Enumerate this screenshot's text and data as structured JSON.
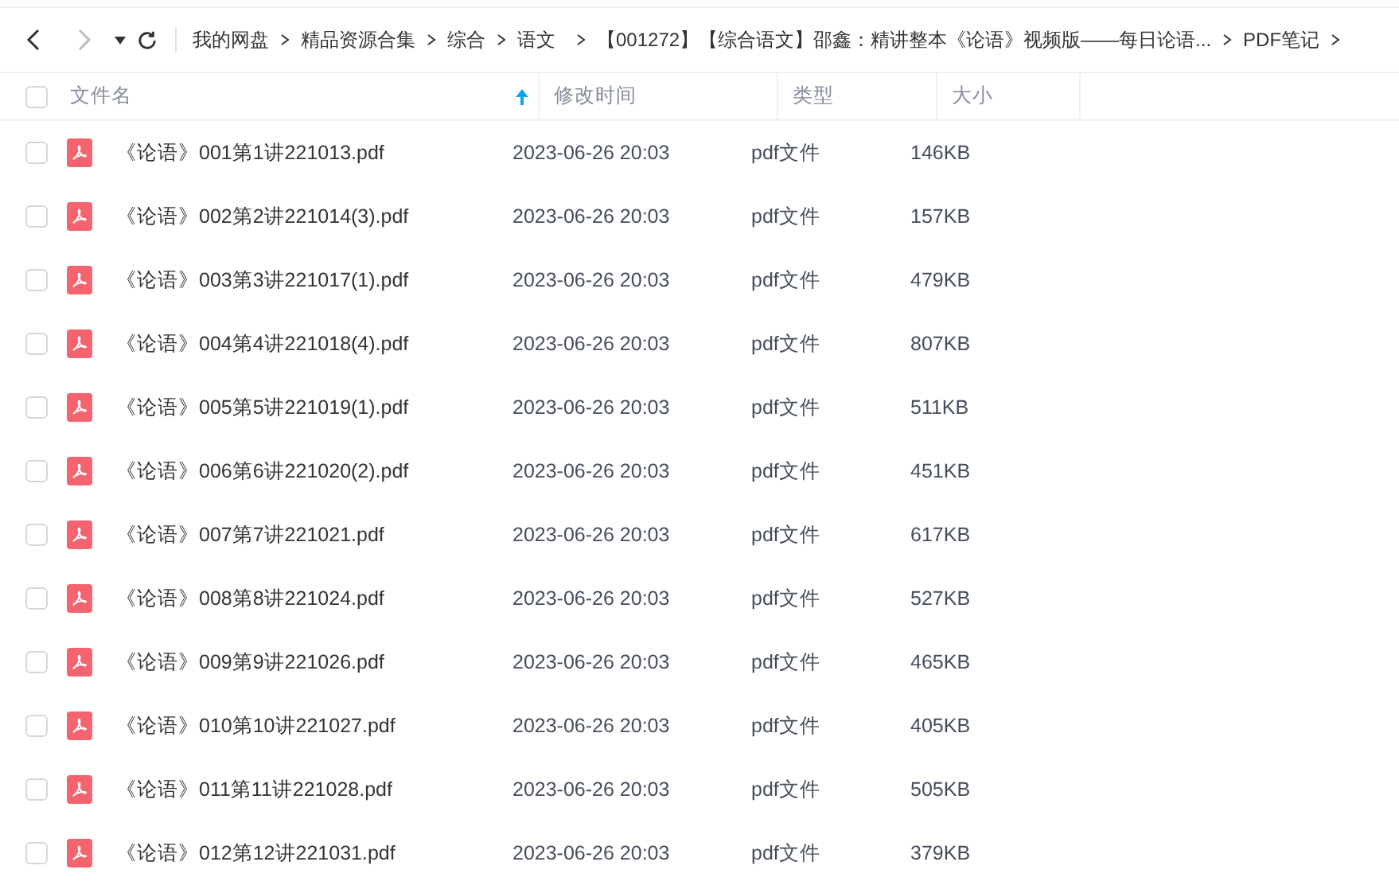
{
  "breadcrumbs": [
    "我的网盘",
    "精品资源合集",
    "综合",
    "语文",
    "【001272】【综合语文】邵鑫：精讲整本《论语》视频版——每日论语...",
    "PDF笔记"
  ],
  "columns": [
    {
      "label": "文件名",
      "sorted": true
    },
    {
      "label": "修改时间",
      "sorted": false
    },
    {
      "label": "类型",
      "sorted": false
    },
    {
      "label": "大小",
      "sorted": false
    }
  ],
  "select_all": {
    "checked": false
  },
  "rows": [
    {
      "name": "《论语》001第1讲221013.pdf",
      "modified": "2023-06-26 20:03",
      "type": "pdf文件",
      "size": "146KB",
      "checked": false
    },
    {
      "name": "《论语》002第2讲221014(3).pdf",
      "modified": "2023-06-26 20:03",
      "type": "pdf文件",
      "size": "157KB",
      "checked": false
    },
    {
      "name": "《论语》003第3讲221017(1).pdf",
      "modified": "2023-06-26 20:03",
      "type": "pdf文件",
      "size": "479KB",
      "checked": false
    },
    {
      "name": "《论语》004第4讲221018(4).pdf",
      "modified": "2023-06-26 20:03",
      "type": "pdf文件",
      "size": "807KB",
      "checked": false
    },
    {
      "name": "《论语》005第5讲221019(1).pdf",
      "modified": "2023-06-26 20:03",
      "type": "pdf文件",
      "size": "511KB",
      "checked": false
    },
    {
      "name": "《论语》006第6讲221020(2).pdf",
      "modified": "2023-06-26 20:03",
      "type": "pdf文件",
      "size": "451KB",
      "checked": false
    },
    {
      "name": "《论语》007第7讲221021.pdf",
      "modified": "2023-06-26 20:03",
      "type": "pdf文件",
      "size": "617KB",
      "checked": false
    },
    {
      "name": "《论语》008第8讲221024.pdf",
      "modified": "2023-06-26 20:03",
      "type": "pdf文件",
      "size": "527KB",
      "checked": false
    },
    {
      "name": "《论语》009第9讲221026.pdf",
      "modified": "2023-06-26 20:03",
      "type": "pdf文件",
      "size": "465KB",
      "checked": false
    },
    {
      "name": "《论语》010第10讲221027.pdf",
      "modified": "2023-06-26 20:03",
      "type": "pdf文件",
      "size": "405KB",
      "checked": false
    },
    {
      "name": "《论语》011第11讲221028.pdf",
      "modified": "2023-06-26 20:03",
      "type": "pdf文件",
      "size": "505KB",
      "checked": false
    },
    {
      "name": "《论语》012第12讲221031.pdf",
      "modified": "2023-06-26 20:03",
      "type": "pdf文件",
      "size": "379KB",
      "checked": false
    }
  ]
}
